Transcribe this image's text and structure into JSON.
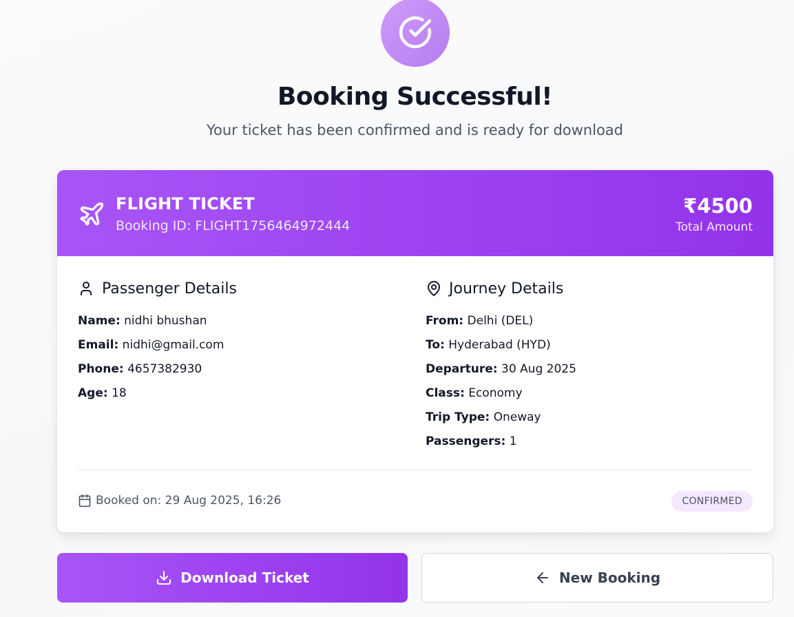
{
  "header": {
    "title": "Booking Successful!",
    "subtitle": "Your ticket has been confirmed and is ready for download",
    "success_icon": "check-circle-icon"
  },
  "ticket": {
    "type": "FLIGHT TICKET",
    "booking_id": "Booking ID: FLIGHT1756464972444",
    "amount": "₹4500",
    "amount_label": "Total Amount",
    "icon": "airplane-icon",
    "accent": "#a855f7"
  },
  "passenger": {
    "title": "Passenger Details",
    "icon": "user-icon",
    "fields": [
      {
        "key": "Name:",
        "value": "nidhi bhushan"
      },
      {
        "key": "Email:",
        "value": "nidhi@gmail.com"
      },
      {
        "key": "Phone:",
        "value": "4657382930"
      },
      {
        "key": "Age:",
        "value": "18"
      }
    ]
  },
  "journey": {
    "title": "Journey Details",
    "icon": "map-pin-icon",
    "fields": [
      {
        "key": "From:",
        "value": "Delhi (DEL)"
      },
      {
        "key": "To:",
        "value": "Hyderabad (HYD)"
      },
      {
        "key": "Departure:",
        "value": "30 Aug 2025"
      },
      {
        "key": "Class:",
        "value": "Economy"
      },
      {
        "key": "Trip Type:",
        "value": "Oneway"
      },
      {
        "key": "Passengers:",
        "value": "1"
      }
    ]
  },
  "footer": {
    "booked_on": "Booked on: 29 Aug 2025, 16:26",
    "status": "CONFIRMED",
    "calendar_icon": "calendar-icon"
  },
  "actions": {
    "download_label": "Download Ticket",
    "new_booking_label": "New Booking"
  }
}
